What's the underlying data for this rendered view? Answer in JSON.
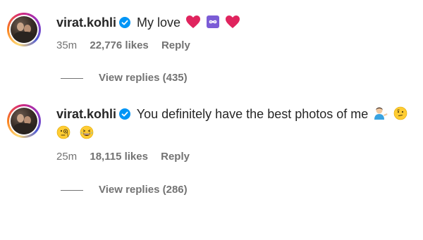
{
  "comments": [
    {
      "username": "virat.kohli",
      "verified": true,
      "text": "My love",
      "emojis": [
        "red-heart",
        "infinity",
        "red-heart"
      ],
      "time": "35m",
      "likes": "22,776 likes",
      "reply_label": "Reply",
      "view_replies": "View replies (435)"
    },
    {
      "username": "virat.kohli",
      "verified": true,
      "text": "You definitely have the best photos of me",
      "emojis": [
        "person-tipping-hand",
        "thinking-face",
        "face-with-monocle",
        "grinning-squinting-face"
      ],
      "time": "25m",
      "likes": "18,115 likes",
      "reply_label": "Reply",
      "view_replies": "View replies (286)"
    }
  ],
  "colors": {
    "text": "#262626",
    "muted": "#737373",
    "verified": "#0095f6",
    "heart": "#e0245e",
    "infinity": "#7b5cd6"
  }
}
